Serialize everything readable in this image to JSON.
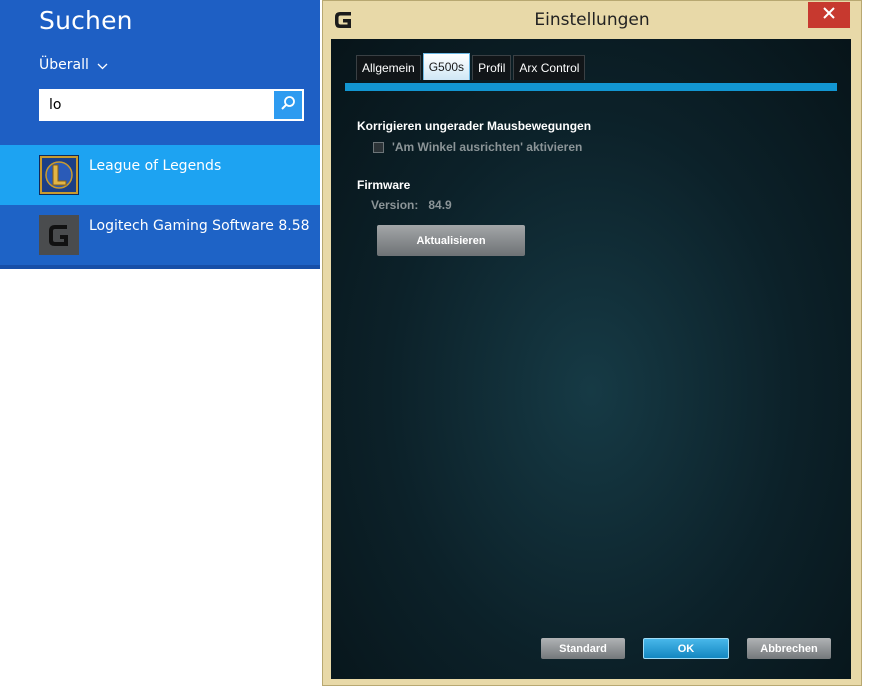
{
  "search": {
    "title": "Suchen",
    "scope_label": "Überall",
    "query": "lo",
    "results": [
      {
        "label": "League of Legends",
        "icon": "league-of-legends-icon"
      },
      {
        "label": "Logitech Gaming Software 8.58",
        "icon": "logitech-g-icon"
      }
    ]
  },
  "settings": {
    "window_title": "Einstellungen",
    "close_symbol": "✕",
    "tabs": [
      {
        "label": "Allgemein",
        "active": false
      },
      {
        "label": "G500s",
        "active": true
      },
      {
        "label": "Profil",
        "active": false
      },
      {
        "label": "Arx Control",
        "active": false
      }
    ],
    "mouse_section_heading": "Korrigieren ungerader Mausbewegungen",
    "angle_snapping_label": "'Am Winkel ausrichten' aktivieren",
    "angle_snapping_checked": false,
    "firmware_heading": "Firmware",
    "version_label": "Version:",
    "version_value": "84.9",
    "update_button": "Aktualisieren",
    "footer": {
      "standard_button": "Standard",
      "ok_button": "OK",
      "cancel_button": "Abbrechen"
    }
  },
  "colors": {
    "search_bg": "#1e5fc4",
    "selected_result_bg": "#1da3f2",
    "accent_blue": "#1296d2",
    "close_red": "#c7392f",
    "window_frame": "#e8d9a8"
  }
}
